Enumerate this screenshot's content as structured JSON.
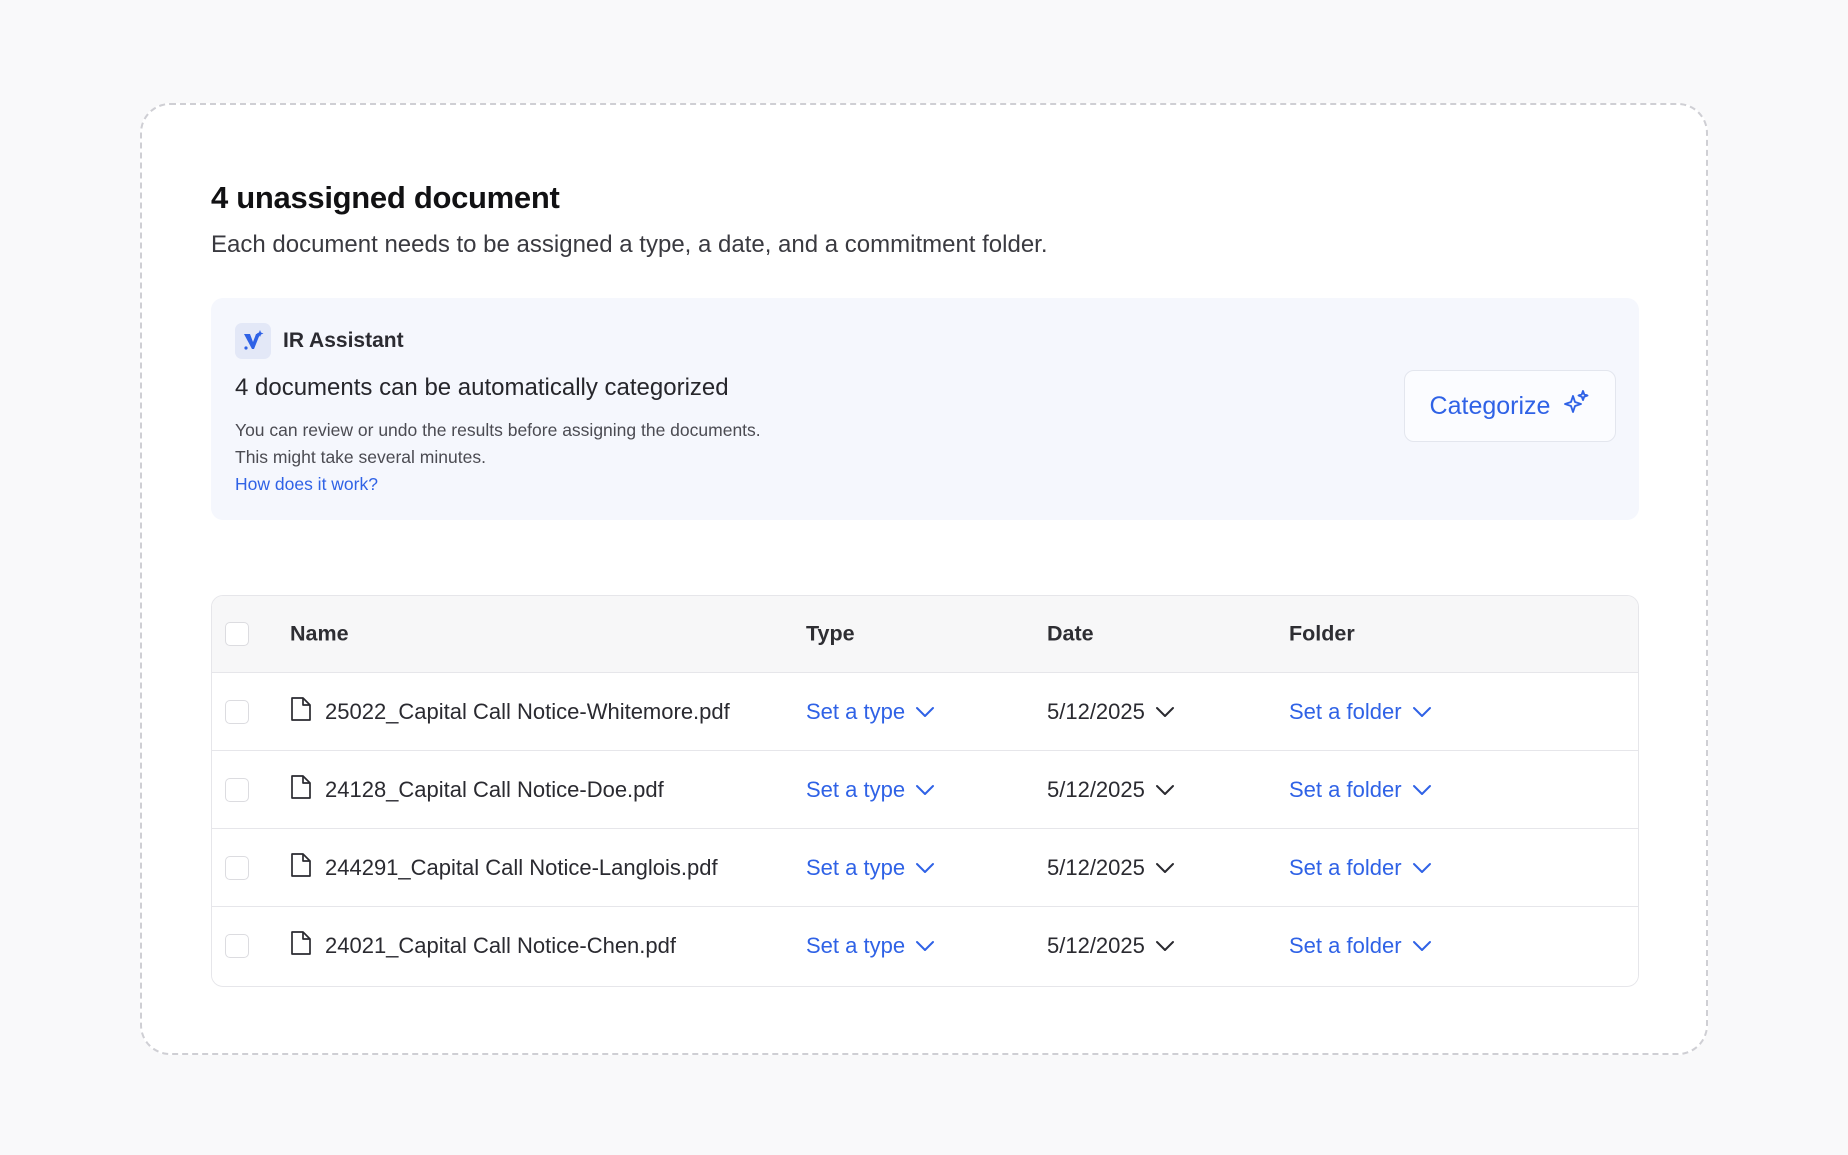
{
  "header": {
    "title": "4 unassigned document",
    "subtitle": "Each document needs to be assigned a type, a date, and a commitment folder."
  },
  "assistant": {
    "name": "IR Assistant",
    "heading": "4 documents can be automatically categorized",
    "description_line1": "You can review or undo the results before assigning the documents.",
    "description_line2": "This might take several minutes.",
    "link": "How does it work?",
    "button_label": "Categorize"
  },
  "table": {
    "columns": [
      "Name",
      "Type",
      "Date",
      "Folder"
    ],
    "rows": [
      {
        "name": "25022_Capital Call Notice-Whitemore.pdf",
        "type": "Set a type",
        "date": "5/12/2025",
        "folder": "Set a folder"
      },
      {
        "name": "24128_Capital Call Notice-Doe.pdf",
        "type": "Set a type",
        "date": "5/12/2025",
        "folder": "Set a folder"
      },
      {
        "name": "244291_Capital Call Notice-Langlois.pdf",
        "type": "Set a type",
        "date": "5/12/2025",
        "folder": "Set a folder"
      },
      {
        "name": "24021_Capital Call Notice-Chen.pdf",
        "type": "Set a type",
        "date": "5/12/2025",
        "folder": "Set a folder"
      }
    ]
  },
  "colors": {
    "accent": "#2f62e6",
    "assistant_bg": "#f5f7fd",
    "page_bg": "#f9f9fa"
  },
  "icons": {
    "assistant_logo": "ir-assistant-logo-icon",
    "categorize": "sparkles-icon",
    "file": "document-icon",
    "dropdown": "chevron-down-icon"
  }
}
